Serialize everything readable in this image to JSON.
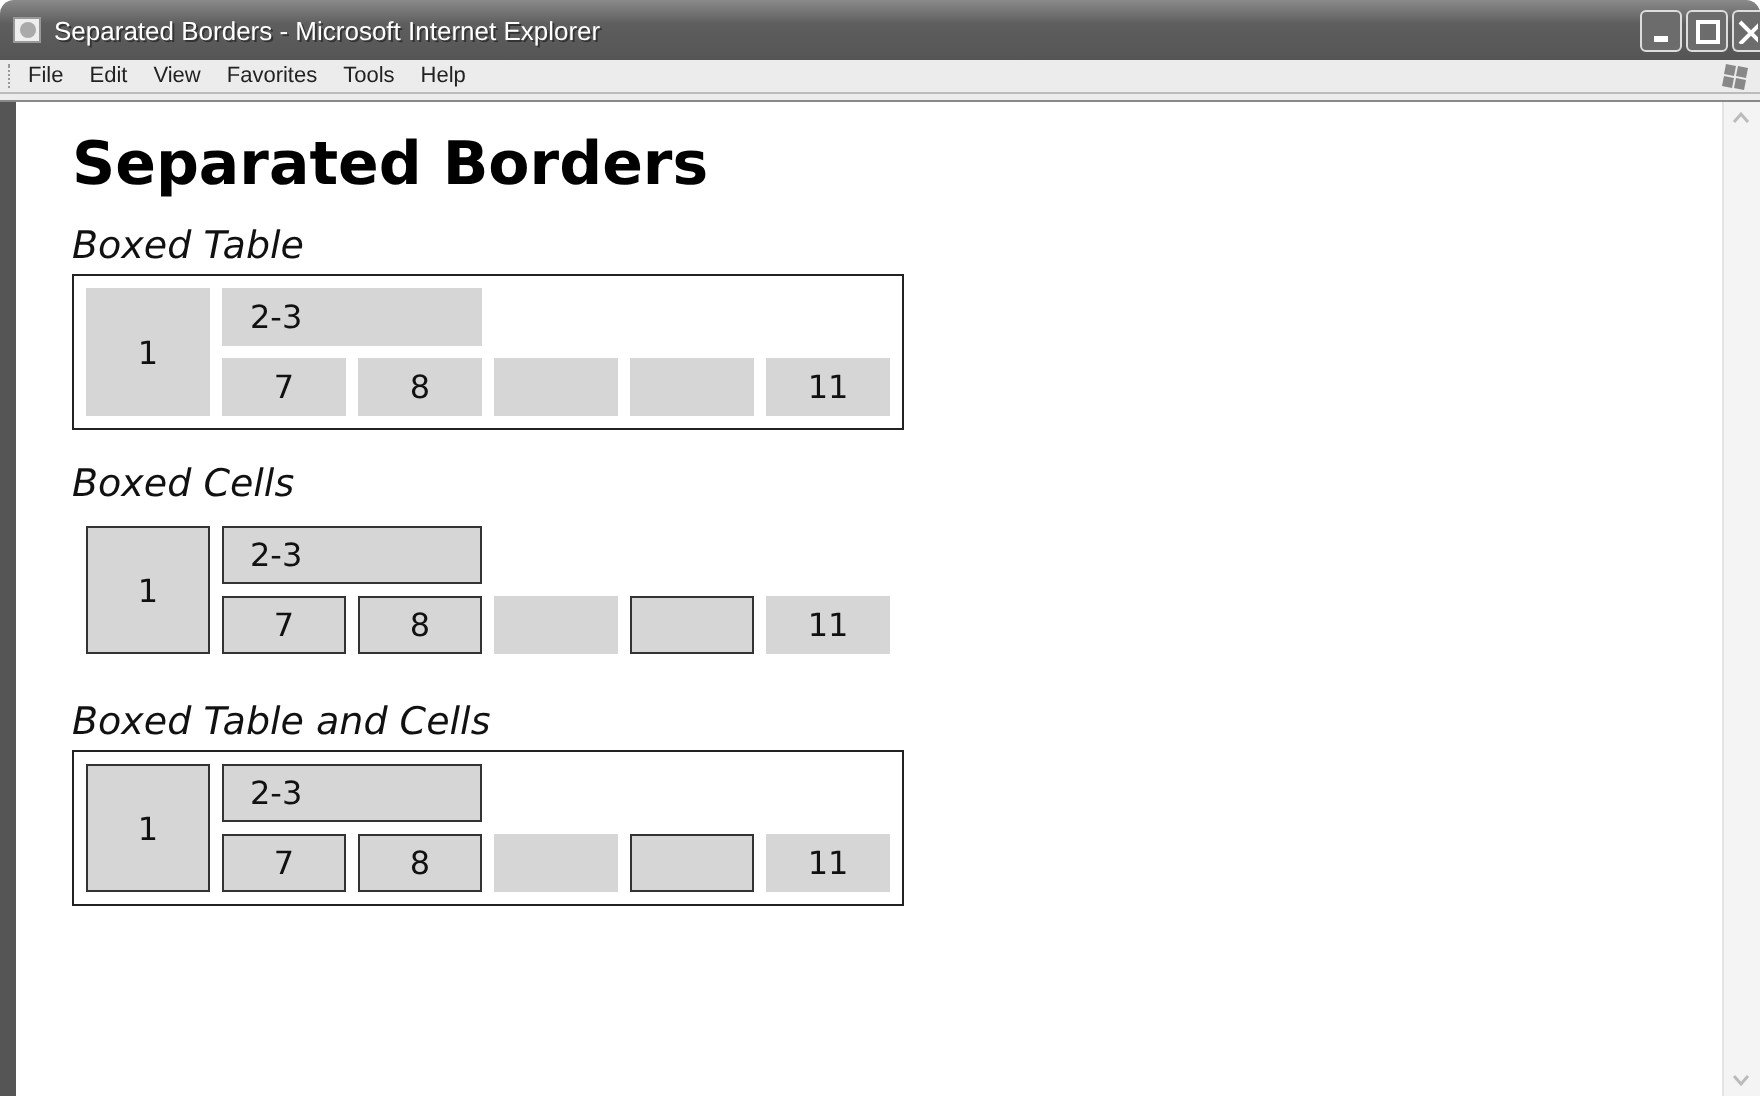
{
  "window": {
    "title": "Separated Borders - Microsoft Internet Explorer"
  },
  "menu": [
    "File",
    "Edit",
    "View",
    "Favorites",
    "Tools",
    "Help"
  ],
  "page": {
    "heading": "Separated Borders",
    "sections": [
      {
        "caption": "Boxed Table",
        "table_bordered": true,
        "cells": [
          {
            "text": "1",
            "kind": "tall",
            "bordered": false
          },
          {
            "text": "2-3",
            "kind": "wide",
            "bordered": false
          },
          {
            "text": "7",
            "kind": "normal",
            "bordered": false
          },
          {
            "text": "8",
            "kind": "normal",
            "bordered": false
          },
          {
            "text": "",
            "kind": "normal",
            "bordered": false
          },
          {
            "text": "",
            "kind": "normal",
            "bordered": false
          },
          {
            "text": "11",
            "kind": "normal",
            "bordered": false
          }
        ]
      },
      {
        "caption": "Boxed Cells",
        "table_bordered": false,
        "cells": [
          {
            "text": "1",
            "kind": "tall",
            "bordered": true
          },
          {
            "text": "2-3",
            "kind": "wide",
            "bordered": true
          },
          {
            "text": "7",
            "kind": "normal",
            "bordered": true
          },
          {
            "text": "8",
            "kind": "normal",
            "bordered": true
          },
          {
            "text": "",
            "kind": "normal",
            "bordered": false
          },
          {
            "text": "",
            "kind": "normal",
            "bordered": true
          },
          {
            "text": "11",
            "kind": "normal",
            "bordered": false
          }
        ]
      },
      {
        "caption": "Boxed Table and Cells",
        "table_bordered": true,
        "cells": [
          {
            "text": "1",
            "kind": "tall",
            "bordered": true
          },
          {
            "text": "2-3",
            "kind": "wide",
            "bordered": true
          },
          {
            "text": "7",
            "kind": "normal",
            "bordered": true
          },
          {
            "text": "8",
            "kind": "normal",
            "bordered": true
          },
          {
            "text": "",
            "kind": "normal",
            "bordered": false
          },
          {
            "text": "",
            "kind": "normal",
            "bordered": true
          },
          {
            "text": "11",
            "kind": "normal",
            "bordered": false
          }
        ]
      }
    ]
  }
}
